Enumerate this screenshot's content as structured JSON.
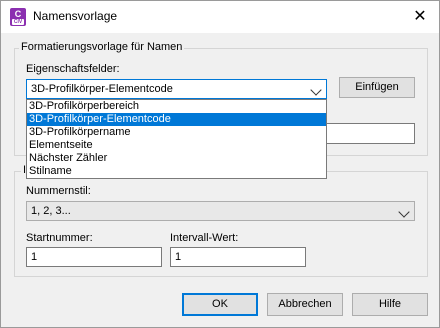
{
  "window": {
    "title": "Namensvorlage",
    "icon": "civil3d-app-icon",
    "icon_text": "C",
    "icon_subtext": "CIV"
  },
  "group_top": {
    "legend": "Formatierungsvorlage für Namen",
    "properties_label": "Eigenschaftsfelder:",
    "selected_property": "3D-Profilkörper-Elementcode",
    "insert_label": "Einfügen"
  },
  "dropdown": {
    "options": [
      "3D-Profilkörperbereich",
      "3D-Profilkörper-Elementcode",
      "3D-Profilkörpername",
      "Elementseite",
      "Nächster Zähler",
      "Stilname"
    ],
    "selected_index": 1
  },
  "name_field": {
    "value": ""
  },
  "group_bottom": {
    "legend_fragment": "I",
    "style_label": "Nummernstil:",
    "style_value": "1, 2, 3...",
    "start_label": "Startnummer:",
    "start_value": "1",
    "interval_label": "Intervall-Wert:",
    "interval_value": "1"
  },
  "buttons": {
    "ok": "OK",
    "cancel": "Abbrechen",
    "help": "Hilfe"
  },
  "colors": {
    "accent": "#0078d7",
    "icon_purple": "#8b2fb0"
  }
}
